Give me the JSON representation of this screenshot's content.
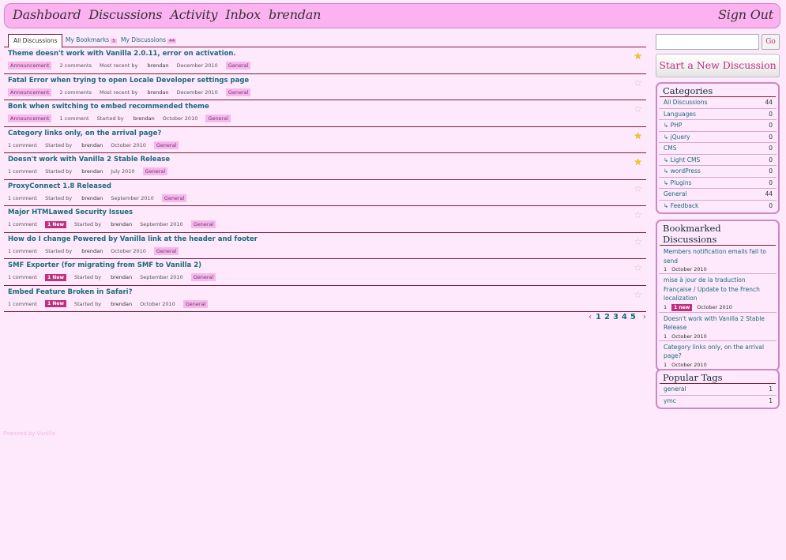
{
  "header": {
    "nav": [
      "Dashboard",
      "Discussions",
      "Activity",
      "Inbox",
      "brendan"
    ],
    "signout": "Sign Out"
  },
  "tabs": [
    {
      "label": "All Discussions",
      "count": ""
    },
    {
      "label": "My Bookmarks",
      "count": "5"
    },
    {
      "label": "My Discussions",
      "count": "44"
    }
  ],
  "discussions": [
    {
      "title": "Theme doesn't work with Vanilla 2.0.11, error on activation.",
      "announcement": "Announcement",
      "comments": "2 comments",
      "new": "",
      "by_label": "Most recent by",
      "user": "brendan",
      "date": "December 2010",
      "category": "General",
      "bookmarked": true
    },
    {
      "title": "Fatal Error when trying to open Locale Developer settings page",
      "announcement": "Announcement",
      "comments": "2 comments",
      "new": "",
      "by_label": "Most recent by",
      "user": "brendan",
      "date": "December 2010",
      "category": "General",
      "bookmarked": false
    },
    {
      "title": "Bonk when switching to embed recommended theme",
      "announcement": "Announcement",
      "comments": "1 comment",
      "new": "",
      "by_label": "Started by",
      "user": "brendan",
      "date": "October 2010",
      "category": "General",
      "bookmarked": false
    },
    {
      "title": "Category links only, on the arrival page?",
      "announcement": "",
      "comments": "1 comment",
      "new": "",
      "by_label": "Started by",
      "user": "brendan",
      "date": "October 2010",
      "category": "General",
      "bookmarked": true
    },
    {
      "title": "Doesn't work with Vanilla 2 Stable Release",
      "announcement": "",
      "comments": "1 comment",
      "new": "",
      "by_label": "Started by",
      "user": "brendan",
      "date": "July 2010",
      "category": "General",
      "bookmarked": true
    },
    {
      "title": "ProxyConnect 1.8 Released",
      "announcement": "",
      "comments": "1 comment",
      "new": "",
      "by_label": "Started by",
      "user": "brendan",
      "date": "September 2010",
      "category": "General",
      "bookmarked": false
    },
    {
      "title": "Major HTMLawed Security Issues",
      "announcement": "",
      "comments": "1 comment",
      "new": "1 New",
      "by_label": "Started by",
      "user": "brendan",
      "date": "September 2010",
      "category": "General",
      "bookmarked": false
    },
    {
      "title": "How do I change Powered by Vanilla link at the header and footer",
      "announcement": "",
      "comments": "1 comment",
      "new": "",
      "by_label": "Started by",
      "user": "brendan",
      "date": "October 2010",
      "category": "General",
      "bookmarked": false
    },
    {
      "title": "SMF Exporter (for migrating from SMF to Vanilla 2)",
      "announcement": "",
      "comments": "1 comment",
      "new": "1 New",
      "by_label": "Started by",
      "user": "brendan",
      "date": "September 2010",
      "category": "General",
      "bookmarked": false
    },
    {
      "title": "Embed Feature Broken in Safari?",
      "announcement": "",
      "comments": "1 comment",
      "new": "1 New",
      "by_label": "Started by",
      "user": "brendan",
      "date": "October 2010",
      "category": "General",
      "bookmarked": false
    }
  ],
  "pager": {
    "prev": "‹",
    "pages": [
      "1",
      "2",
      "3",
      "4",
      "5"
    ],
    "next": "›"
  },
  "footer": {
    "powered": "Powered by Vanilla"
  },
  "sidebar": {
    "search_placeholder": "",
    "go_label": "Go",
    "new_discussion_label": "Start a New Discussion",
    "categories_title": "Categories",
    "categories": [
      {
        "name": "All Discussions",
        "count": "44"
      },
      {
        "name": "Languages",
        "count": "0"
      },
      {
        "name": "↳ PHP",
        "count": "0"
      },
      {
        "name": "↳ jQuery",
        "count": "0"
      },
      {
        "name": "CMS",
        "count": "0"
      },
      {
        "name": "↳ Light CMS",
        "count": "0"
      },
      {
        "name": "↳ wordPress",
        "count": "0"
      },
      {
        "name": "↳ Plugins",
        "count": "0"
      },
      {
        "name": "General",
        "count": "44"
      },
      {
        "name": "↳ Feedback",
        "count": "0"
      }
    ],
    "bookmarked_title": "Bookmarked Discussions",
    "bookmarked": [
      {
        "title": "Members notification emails fail to send",
        "count": "1",
        "new": "",
        "date": "October 2010"
      },
      {
        "title": "mise à jour de la traduction Française / Update to the French localization",
        "count": "1",
        "new": "1 new",
        "date": "October 2010"
      },
      {
        "title": "Doesn't work with Vanilla 2 Stable Release",
        "count": "1",
        "new": "",
        "date": "October 2010"
      },
      {
        "title": "Category links only, on the arrival page?",
        "count": "1",
        "new": "",
        "date": "October 2010"
      }
    ],
    "tags_title": "Popular Tags",
    "tags": [
      {
        "name": "general",
        "count": "1"
      },
      {
        "name": "ymc",
        "count": "1"
      }
    ]
  },
  "colors": {
    "accent": "#c0307e",
    "link": "#1b6a7a",
    "header_bg": "#fcb2f0",
    "page_bg": "#fde9fb",
    "star_on": "#f0c419"
  }
}
